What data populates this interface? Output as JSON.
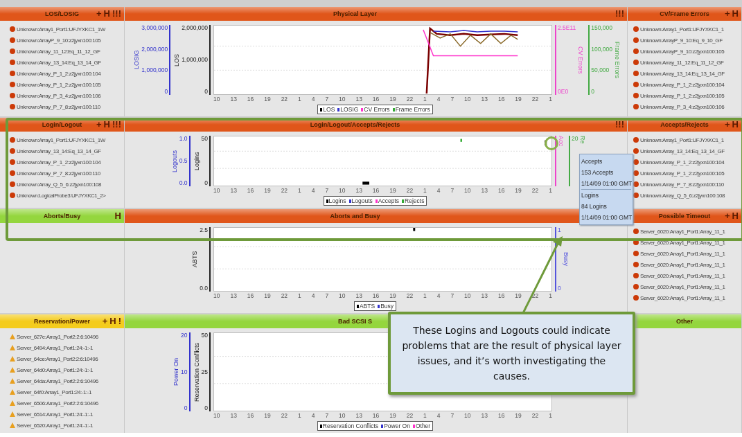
{
  "rows": [
    {
      "panels": [
        {
          "kind": "list",
          "title": "LOS/LOSIG",
          "color": "#e0561a",
          "actions": [
            "+",
            "H",
            "!!!"
          ],
          "items": [
            {
              "text": "Unknown:Array1_Port1:UFJYXKC1_1W",
              "kind": "error"
            },
            {
              "text": "Unknown:ArrayP_9_10:z2jyxn100:105",
              "kind": "error"
            },
            {
              "text": "Unknown:Array_11_12:Eq_11_12_GF",
              "kind": "error"
            },
            {
              "text": "Unknown:Array_13_14:Eq_13_14_GF",
              "kind": "error"
            },
            {
              "text": "Unknown:Array_P_1_2:z2jyxn100:104",
              "kind": "error"
            },
            {
              "text": "Unknown:Array_P_1_2:z2jyxn100:105",
              "kind": "error"
            },
            {
              "text": "Unknown:Array_P_3_4:z2jyxn100:106",
              "kind": "error"
            },
            {
              "text": "Unknown:Array_P_7_8:z2jyxn100:110",
              "kind": "error"
            }
          ]
        },
        {
          "kind": "chart",
          "title": "Physical Layer",
          "color": "#e0561a",
          "actions": [
            "!!!"
          ],
          "chart": {
            "kind": "lines",
            "left_axes": [
              {
                "title": "LOSIG",
                "color": "#3333cc",
                "ticks": [
                  "3,000,000",
                  "2,000,000",
                  "1,000,000",
                  "0"
                ]
              },
              {
                "title": "LOS",
                "color": "#222222",
                "ticks": [
                  "2,000,000",
                  "1,000,000",
                  "0"
                ]
              }
            ],
            "right_axes": [
              {
                "title": "CV Errors",
                "color": "#ee44cc",
                "ticks": [
                  "2.5E11",
                  "0E0"
                ]
              },
              {
                "title": "Frame Errors",
                "color": "#44aa44",
                "ticks": [
                  "150,000",
                  "100,000",
                  "50,000",
                  "0"
                ]
              }
            ],
            "xticks": [
              "10",
              "13",
              "16",
              "19",
              "22",
              "1",
              "4",
              "7",
              "10",
              "13",
              "16",
              "19",
              "22",
              "1",
              "4",
              "7",
              "10",
              "13",
              "16",
              "19",
              "22",
              "1"
            ],
            "legend": [
              {
                "name": "LOS",
                "color": "#000000"
              },
              {
                "name": "LOSIG",
                "color": "#3333cc"
              },
              {
                "name": "CV Errors",
                "color": "#ff33cc"
              },
              {
                "name": "Frame Errors",
                "color": "#33aa33"
              }
            ]
          }
        },
        {
          "kind": "list",
          "title": "CV/Frame Errors",
          "color": "#e0561a",
          "actions": [
            "+",
            "H"
          ],
          "items": [
            {
              "text": "Unknown:Array1_Port1:UFJYXKC1_1",
              "kind": "error"
            },
            {
              "text": "Unknown:ArrayP_9_10:Eq_9_10_GF",
              "kind": "error"
            },
            {
              "text": "Unknown:ArrayP_9_10:z2jyxn100:105",
              "kind": "error"
            },
            {
              "text": "Unknown:Array_11_12:Eq_11_12_GF",
              "kind": "error"
            },
            {
              "text": "Unknown:Array_13_14:Eq_13_14_GF",
              "kind": "error"
            },
            {
              "text": "Unknown:Array_P_1_2:z2jyxn100:104",
              "kind": "error"
            },
            {
              "text": "Unknown:Array_P_1_2:z2jyxn100:105",
              "kind": "error"
            },
            {
              "text": "Unknown:Array_P_3_4:z2jyxn100:106",
              "kind": "error"
            }
          ]
        }
      ]
    },
    {
      "panels": [
        {
          "kind": "list",
          "title": "Login/Logout",
          "color": "#e0561a",
          "actions": [
            "+",
            "H",
            "!!!"
          ],
          "items": [
            {
              "text": "Unknown:Array1_Port1:UFJYXKC1_1W",
              "kind": "error"
            },
            {
              "text": "Unknown:Array_13_14:Eq_13_14_GF",
              "kind": "error"
            },
            {
              "text": "Unknown:Array_P_1_2:z2jyxn100:104",
              "kind": "error"
            },
            {
              "text": "Unknown:Array_P_7_8:z2jyxn100:110",
              "kind": "error"
            },
            {
              "text": "Unknown:Array_Q_5_6:z2jyxn100:108",
              "kind": "error"
            },
            {
              "text": "Unknown:LogicalProbe3:UFJYXKC1_2>",
              "kind": "error"
            }
          ]
        },
        {
          "kind": "chart",
          "title": "Login/Logout/Accepts/Rejects",
          "color": "#e0561a",
          "actions": [
            "!!!"
          ],
          "chart": {
            "kind": "points",
            "left_axes": [
              {
                "title": "Logouts",
                "color": "#3333cc",
                "ticks": [
                  "1.0",
                  "0.5",
                  "0.0"
                ]
              },
              {
                "title": "Logins",
                "color": "#222222",
                "ticks": [
                  "50",
                  "0"
                ]
              }
            ],
            "right_axes": [
              {
                "title": "Acc",
                "color": "#ee44cc"
              },
              {
                "title": "Re",
                "color": "#44aa44",
                "ticks": [
                  "20"
                ]
              }
            ],
            "xticks": [
              "10",
              "13",
              "16",
              "19",
              "22",
              "1",
              "4",
              "7",
              "10",
              "13",
              "16",
              "19",
              "22",
              "1",
              "4",
              "7",
              "10",
              "13",
              "16",
              "19",
              "22",
              "1"
            ],
            "legend": [
              {
                "name": "Logins",
                "color": "#000000"
              },
              {
                "name": "Logouts",
                "color": "#3333cc"
              },
              {
                "name": "Accepts",
                "color": "#ff33cc"
              },
              {
                "name": "Rejects",
                "color": "#33aa33"
              }
            ]
          }
        },
        {
          "kind": "list",
          "title": "Accepts/Rejects",
          "color": "#e0561a",
          "actions": [
            "+",
            "H"
          ],
          "items": [
            {
              "text": "Unknown:Array1_Port1:UFJYXKC1_1",
              "kind": "error"
            },
            {
              "text": "Unknown:Array_13_14:Eq_13_14_GF",
              "kind": "error"
            },
            {
              "text": "Unknown:Array_P_1_2:z2jyxn100:104",
              "kind": "error"
            },
            {
              "text": "Unknown:Array_P_1_2:z2jyxn100:105",
              "kind": "error"
            },
            {
              "text": "Unknown:Array_P_7_8:z2jyxn100:110",
              "kind": "error"
            },
            {
              "text": "Unknown:Array_Q_5_6:z2jyxn100:108",
              "kind": "error"
            }
          ]
        }
      ]
    },
    {
      "panels": [
        {
          "kind": "empty",
          "title": "Aborts/Busy",
          "color": "#94d63e",
          "actions": [
            "H"
          ]
        },
        {
          "kind": "chart",
          "title": "Aborts and Busy",
          "color": "#e0561a",
          "chart": {
            "kind": "single",
            "left_axes": [
              {
                "title": "ABTS",
                "color": "#222222",
                "ticks": [
                  "2.5",
                  "0.0"
                ]
              }
            ],
            "right_axes": [
              {
                "title": "Busy",
                "color": "#5555dd",
                "ticks": [
                  "1",
                  "0"
                ]
              }
            ],
            "xticks": [
              "10",
              "13",
              "16",
              "19",
              "22",
              "1",
              "4",
              "7",
              "10",
              "13",
              "16",
              "19",
              "22",
              "1",
              "4",
              "7",
              "10",
              "13",
              "16",
              "19",
              "22",
              "1"
            ],
            "legend": [
              {
                "name": "ABTS",
                "color": "#000000"
              },
              {
                "name": "Busy",
                "color": "#3333cc"
              }
            ]
          }
        },
        {
          "kind": "list",
          "title": "Possible Timeout",
          "color": "#e0561a",
          "actions": [
            "+",
            "H"
          ],
          "items": [
            {
              "text": "Server_6020:Array1_Port1:Array_11_1",
              "kind": "error"
            },
            {
              "text": "Server_6020:Array1_Port1:Array_11_1",
              "kind": "error"
            },
            {
              "text": "Server_6020:Array1_Port1:Array_11_1",
              "kind": "error"
            },
            {
              "text": "Server_6020:Array1_Port1:Array_11_1",
              "kind": "error"
            },
            {
              "text": "Server_6020:Array1_Port1:Array_11_1",
              "kind": "error"
            },
            {
              "text": "Server_6020:Array1_Port1:Array_11_1",
              "kind": "error"
            },
            {
              "text": "Server_6020:Array1_Port1:Array_11_1",
              "kind": "error"
            }
          ]
        }
      ]
    },
    {
      "panels": [
        {
          "kind": "list",
          "title": "Reservation/Power",
          "color": "#f4cc1c",
          "actions": [
            "+",
            "H",
            "!"
          ],
          "items": [
            {
              "text": "Server_627e:Array1_Port2:2:6:10496",
              "kind": "warning"
            },
            {
              "text": "Server_6494:Array1_Port1:24:-1:-1",
              "kind": "warning"
            },
            {
              "text": "Server_64ce:Array1_Port2:2:6:10496",
              "kind": "warning"
            },
            {
              "text": "Server_64d0:Array1_Port1:24:-1:-1",
              "kind": "warning"
            },
            {
              "text": "Server_64da:Array1_Port2:2:6:10496",
              "kind": "warning"
            },
            {
              "text": "Server_64f0:Array1_Port1:24:-1:-1",
              "kind": "warning"
            },
            {
              "text": "Server_6506:Array1_Port2:2:6:10496",
              "kind": "warning"
            },
            {
              "text": "Server_6514:Array1_Port1:24:-1:-1",
              "kind": "warning"
            },
            {
              "text": "Server_6520:Array1_Port1:24:-1:-1",
              "kind": "warning"
            }
          ]
        },
        {
          "kind": "chart",
          "title": "Bad SCSI S",
          "color": "#94d63e",
          "chart": {
            "kind": "empty",
            "left_axes": [
              {
                "title": "Power On",
                "color": "#3333cc",
                "ticks": [
                  "20",
                  "10",
                  "0"
                ]
              },
              {
                "title": "Reservation Conflicts",
                "color": "#222222",
                "ticks": [
                  "50",
                  "25",
                  "0"
                ]
              }
            ],
            "xticks": [
              "10",
              "13",
              "16",
              "19",
              "22",
              "1",
              "4",
              "7",
              "10",
              "13",
              "16",
              "19",
              "22",
              "1",
              "4",
              "7",
              "10",
              "13",
              "16",
              "19",
              "22",
              "1"
            ],
            "legend": [
              {
                "name": "Reservation Conflicts",
                "color": "#000000"
              },
              {
                "name": "Power On",
                "color": "#3333cc"
              },
              {
                "name": "Other",
                "color": "#ff33cc"
              }
            ]
          }
        },
        {
          "kind": "empty",
          "title": "Other",
          "color": "#94d63e"
        }
      ]
    }
  ],
  "tooltip": [
    {
      "title": "Accepts",
      "value": "153 Accepts",
      "time": "1/14/09 01:00 GMT"
    },
    {
      "title": "Logins",
      "value": "84 Logins",
      "time": "1/14/09 01:00 GMT"
    }
  ],
  "callout": "These Logins and Logouts could indicate problems that are the result of physical layer issues, and it’s worth investigating the causes."
}
